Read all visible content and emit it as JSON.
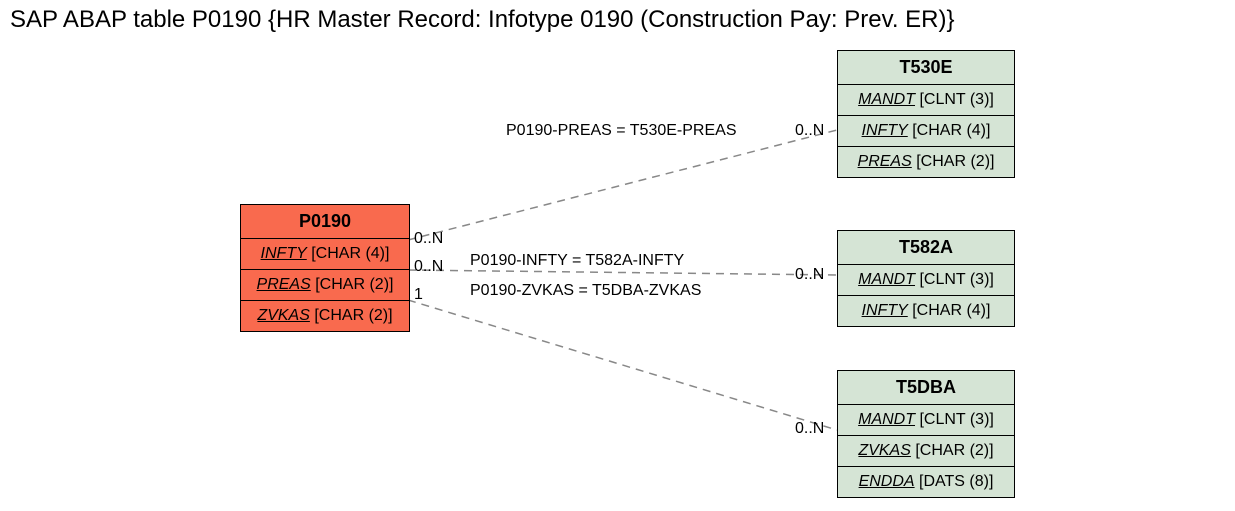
{
  "title": "SAP ABAP table P0190 {HR Master Record: Infotype 0190 (Construction Pay: Prev. ER)}",
  "entities": {
    "p0190": {
      "name": "P0190",
      "fields": [
        {
          "fk": "INFTY",
          "type": "[CHAR (4)]"
        },
        {
          "fk": "PREAS",
          "type": "[CHAR (2)]"
        },
        {
          "fk": "ZVKAS",
          "type": "[CHAR (2)]"
        }
      ]
    },
    "t530e": {
      "name": "T530E",
      "fields": [
        {
          "fk": "MANDT",
          "type": "[CLNT (3)]"
        },
        {
          "fk": "INFTY",
          "type": "[CHAR (4)]"
        },
        {
          "fk": "PREAS",
          "type": "[CHAR (2)]"
        }
      ]
    },
    "t582a": {
      "name": "T582A",
      "fields": [
        {
          "fk": "MANDT",
          "type": "[CLNT (3)]"
        },
        {
          "fk": "INFTY",
          "type": "[CHAR (4)]"
        }
      ]
    },
    "t5dba": {
      "name": "T5DBA",
      "fields": [
        {
          "fk": "MANDT",
          "type": "[CLNT (3)]"
        },
        {
          "fk": "ZVKAS",
          "type": "[CHAR (2)]"
        },
        {
          "fk": "ENDDA",
          "type": "[DATS (8)]"
        }
      ]
    }
  },
  "edges": {
    "e1": {
      "label": "P0190-PREAS = T530E-PREAS",
      "leftCard": "0..N",
      "rightCard": "0..N"
    },
    "e2": {
      "label": "P0190-INFTY = T582A-INFTY",
      "leftCard": "0..N",
      "rightCard": "0..N"
    },
    "e3": {
      "label": "P0190-ZVKAS = T5DBA-ZVKAS",
      "leftCard": "1",
      "rightCard": "0..N"
    }
  }
}
